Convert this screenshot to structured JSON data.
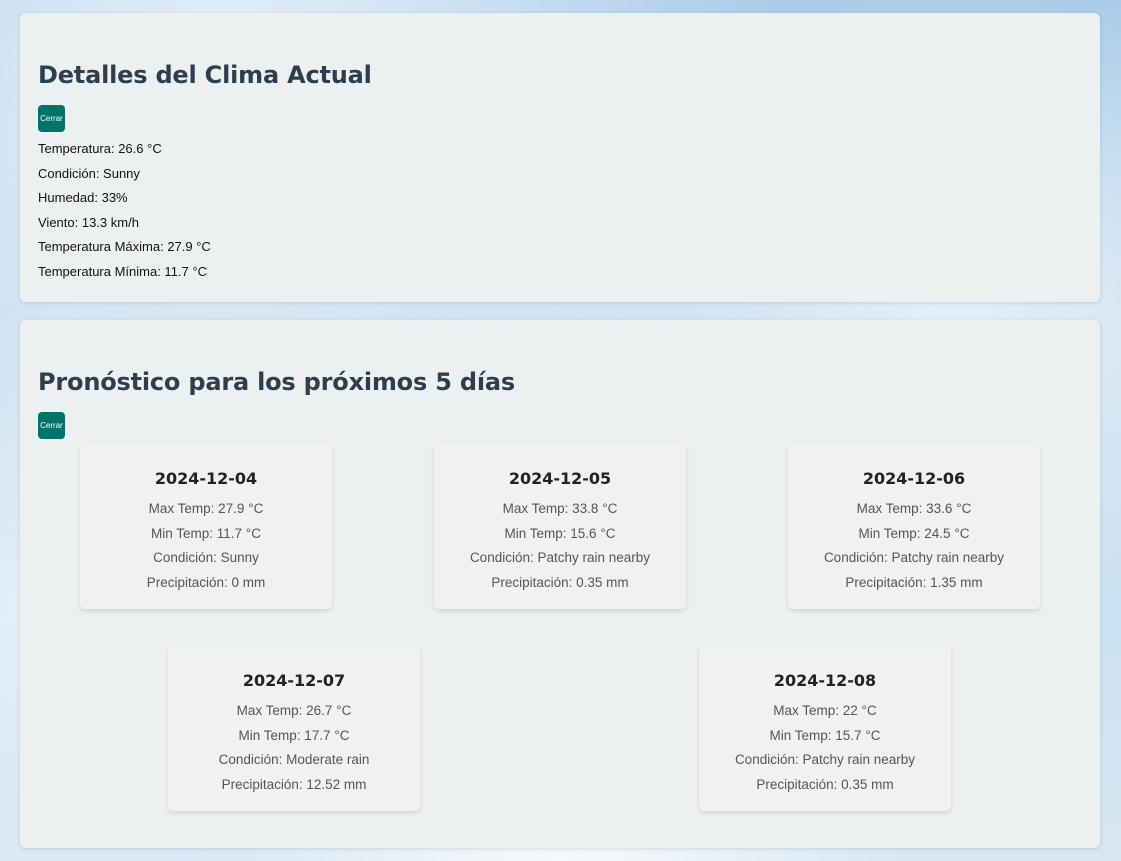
{
  "current": {
    "title": "Detalles del Clima Actual",
    "close_label": "Cerrar",
    "temperature": "Temperatura: 26.6 °C",
    "condition": "Condición: Sunny",
    "humidity": "Humedad: 33%",
    "wind": "Viento: 13.3 km/h",
    "max_temp": "Temperatura Máxima: 27.9 °C",
    "min_temp": "Temperatura Mínima: 11.7 °C"
  },
  "forecast": {
    "title": "Pronóstico para los próximos 5 días",
    "close_label": "Cerrar",
    "days": [
      {
        "date": "2024-12-04",
        "max": "Max Temp: 27.9 °C",
        "min": "Min Temp: 11.7 °C",
        "condition": "Condición: Sunny",
        "precip": "Precipitación: 0 mm"
      },
      {
        "date": "2024-12-05",
        "max": "Max Temp: 33.8 °C",
        "min": "Min Temp: 15.6 °C",
        "condition": "Condición: Patchy rain nearby",
        "precip": "Precipitación: 0.35 mm"
      },
      {
        "date": "2024-12-06",
        "max": "Max Temp: 33.6 °C",
        "min": "Min Temp: 24.5 °C",
        "condition": "Condición: Patchy rain nearby",
        "precip": "Precipitación: 1.35 mm"
      },
      {
        "date": "2024-12-07",
        "max": "Max Temp: 26.7 °C",
        "min": "Min Temp: 17.7 °C",
        "condition": "Condición: Moderate rain",
        "precip": "Precipitación: 12.52 mm"
      },
      {
        "date": "2024-12-08",
        "max": "Max Temp: 22 °C",
        "min": "Min Temp: 15.7 °C",
        "condition": "Condición: Patchy rain nearby",
        "precip": "Precipitación: 0.35 mm"
      }
    ]
  },
  "colors": {
    "accent": "#00736a",
    "heading": "#2c3e50",
    "card_bg": "#ecf0f1",
    "day_bg": "#f1f1f1"
  }
}
